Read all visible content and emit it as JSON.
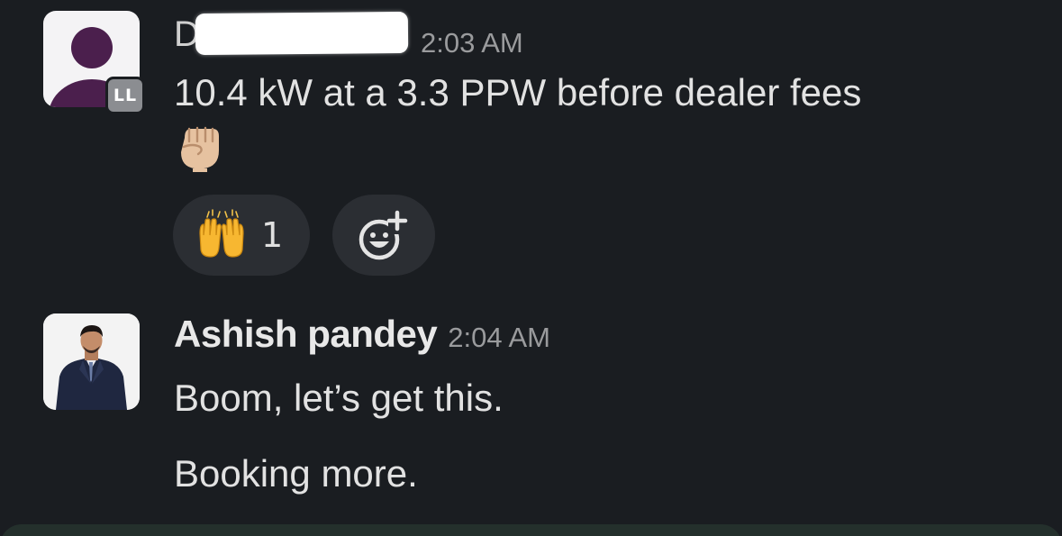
{
  "messages": [
    {
      "sender_prefix": "D",
      "sender_redacted": true,
      "timestamp": "2:03 AM",
      "org_badge": "LL",
      "text": "10.4 kW at a 3.3 PPW before dealer fees",
      "emoji": "raised-fist-light-skin",
      "reactions": [
        {
          "emoji": "raising-hands",
          "count": "1"
        }
      ],
      "add_reaction_icon": "add-reaction-icon"
    },
    {
      "sender": "Ashish pandey",
      "timestamp": "2:04 AM",
      "lines": [
        "Boom, let’s get this.",
        "Booking more."
      ]
    }
  ],
  "colors": {
    "background": "#1a1d21",
    "reaction_pill": "#2b2e33",
    "default_avatar": "#4b1f4d",
    "composer": "#24302c"
  }
}
